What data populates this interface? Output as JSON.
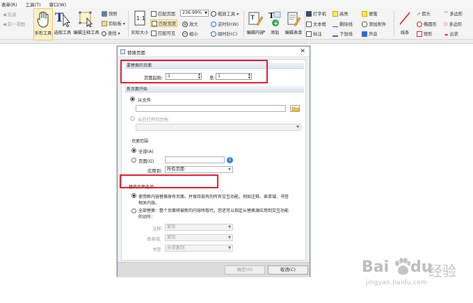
{
  "menubar": [
    "表单(R)",
    "工具(T)",
    "窗口(W)"
  ],
  "ribbon": {
    "nav_back": "后退",
    "nav_prev_view": "前一视图",
    "hand_tool": "手形工具",
    "select_text": "选取工具",
    "edit_annot": "编辑注释工具",
    "snapshot": "快照",
    "clipboard": "剪贴板",
    "find": "查找",
    "actual_size": "实际大小",
    "fit_page": "匹配页面",
    "fit_width": "匹配宽度",
    "fit_visible": "匹配可见",
    "zoom_value": "236.99%",
    "zoom_tool": "缩放工具",
    "zoom_in": "放大",
    "zoom_out": "缩小",
    "rotate_ccw": "逆时针(W)",
    "rotate_cw": "顺时针(C)",
    "edit_content": "编辑内容",
    "add": "添加",
    "edit_form": "编辑表单",
    "typewriter": "打字机",
    "textbox": "文本框",
    "note": "标注",
    "highlight": "高亮",
    "strikeout": "删除线",
    "underline": "下划线",
    "sticky": "便笺",
    "attach_file": "添加附件",
    "sound": "声音",
    "line": "线条",
    "arrow": "箭头",
    "ellipse": "椭圆形",
    "rectangle": "矩形",
    "polygon": "多边形",
    "polyline": "多边形",
    "cloud": "云状"
  },
  "dialog": {
    "title": "替换页面",
    "close_glyph": "✕",
    "sec_replace": "要替换的页面",
    "page_from_label": "页面起始:",
    "page_from_value": "1",
    "page_to_label": "至:",
    "page_to_value": "1",
    "sec_new_start": "新页面开始",
    "from_file": "从文件",
    "file_value": "",
    "from_open_doc": "从已打开的文档",
    "sec_page_range": "页面范围",
    "all": "全部(A)",
    "pages": "页面(G)",
    "pages_value": "",
    "apply_to_label": "应用到:",
    "apply_to_value": "所有页面",
    "sec_options": "替换页面选项:",
    "opt1_line1": "使用新内容替换原有页面，并保持现有的所有交互功能，例如注释、表单域、书签",
    "opt1_line2": "相关内容。",
    "opt2_line1": "全部替换：整个页面将被新的内容所取代，您还可以指定从替换源应用到交互功能",
    "opt2_line2": "的动作：",
    "annot_label": "注释:",
    "annot_value": "复制",
    "form_label": "表单域:",
    "form_value": "复制",
    "bookmark_label": "书签:",
    "bookmark_value": "全部复制",
    "ok": "确定(O)",
    "cancel": "取消(C)"
  },
  "watermark": {
    "bai": "Bai",
    "du": "du",
    "jingyan": "经验",
    "url": "jingyan.baidu.com"
  },
  "colors": {
    "highlight_border": "#e01b2c",
    "accent_blue": "#2e7ee6"
  }
}
